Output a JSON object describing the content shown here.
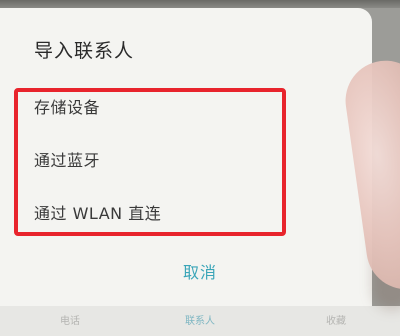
{
  "dialog": {
    "title": "导入联系人",
    "options": [
      {
        "label": "存储设备"
      },
      {
        "label": "通过蓝牙"
      },
      {
        "label": "通过 WLAN 直连"
      }
    ],
    "cancel_label": "取消"
  },
  "tabbar": {
    "tabs": [
      {
        "label": "电话"
      },
      {
        "label": "联系人"
      },
      {
        "label": "收藏"
      }
    ]
  },
  "colors": {
    "highlight_border": "#e8242c",
    "accent": "#3aa5b8",
    "dialog_bg": "#f4f4f1"
  }
}
